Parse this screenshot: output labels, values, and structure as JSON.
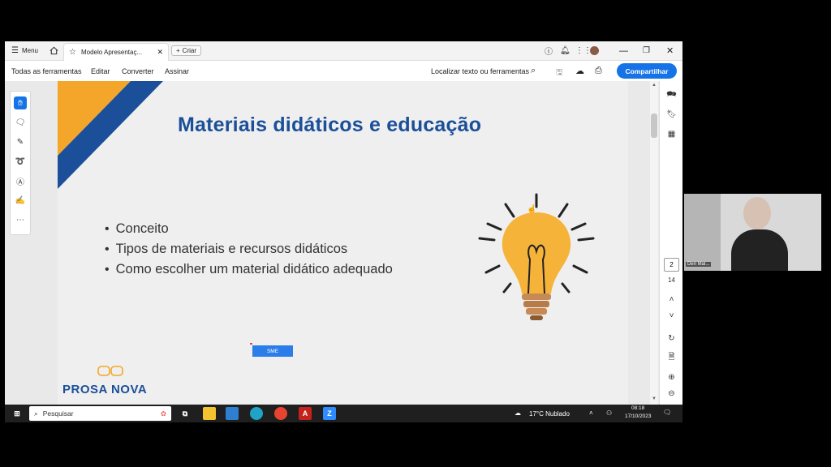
{
  "titlebar": {
    "menu_label": "Menu",
    "tab_title": "Modelo Apresentaç...",
    "new_label": "Criar"
  },
  "menubar": {
    "items": [
      "Todas as ferramentas",
      "Editar",
      "Converter",
      "Assinar"
    ],
    "search_placeholder": "Localizar texto ou ferramentas",
    "share_label": "Compartilhar"
  },
  "slide": {
    "title": "Materiais didáticos e educação",
    "bullets": [
      "Conceito",
      "Tipos de materiais e recursos didáticos",
      "Como escolher um material didático adequado"
    ],
    "badge": "SME",
    "logo_text": "PROSA NOVA",
    "colors": {
      "title": "#1b4f9a",
      "stripe_blue": "#1b4f9a",
      "stripe_yellow": "#f4a62a"
    }
  },
  "right_panel": {
    "page_current": "2",
    "page_total": "14"
  },
  "webcam": {
    "name_label": "Deri Mal..."
  },
  "taskbar": {
    "search_placeholder": "Pesquisar",
    "weather": "17°C  Nublado",
    "time": "08:18",
    "date": "17/10/2023"
  }
}
